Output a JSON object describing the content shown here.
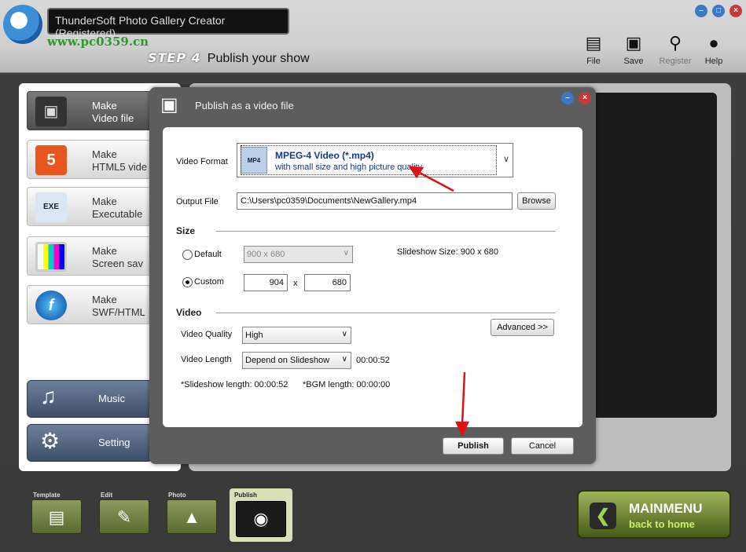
{
  "window": {
    "title": "ThunderSoft Photo Gallery Creator (Registered)",
    "watermark": "www.pc0359.cn",
    "min": "–",
    "max": "□",
    "close": "×"
  },
  "step": {
    "label": "STEP 4",
    "title": "Publish your show"
  },
  "toolbar": [
    {
      "label": "File",
      "icon": "folder-icon"
    },
    {
      "label": "Save",
      "icon": "floppy-icon"
    },
    {
      "label": "Register",
      "icon": "key-icon"
    },
    {
      "label": "Help",
      "icon": "lightbulb-icon"
    }
  ],
  "make_options": [
    {
      "label": "Make\nVideo file",
      "icon": "film-icon",
      "active": true
    },
    {
      "label": "Make\nHTML5 vide",
      "icon": "html5-icon",
      "active": false
    },
    {
      "label": "Make\nExecutable",
      "icon": "exe-icon",
      "active": false
    },
    {
      "label": "Make\nScreen sav",
      "icon": "monitor-icon",
      "active": false
    },
    {
      "label": "Make\nSWF/HTML",
      "icon": "flash-icon",
      "active": false
    }
  ],
  "side_buttons": {
    "music": "Music",
    "setting": "Setting"
  },
  "bottom_tabs": {
    "template": "Template",
    "edit": "Edit",
    "photo": "Photo",
    "publish": "Publish"
  },
  "mainmenu": {
    "title": "MAINMENU",
    "subtitle": "back to home"
  },
  "dialog": {
    "title": "Publish as a video file",
    "video_format_label": "Video Format",
    "format_name": "MPEG-4 Video (*.mp4)",
    "format_desc": "with small size and high picture quality",
    "format_icon_text": "MP4",
    "output_file_label": "Output File",
    "output_file_value": "C:\\Users\\pc0359\\Documents\\NewGallery.mp4",
    "browse": "Browse",
    "size_section": "Size",
    "default_label": "Default",
    "default_size": "900 x 680",
    "slideshow_size": "Slideshow Size: 900 x 680",
    "custom_label": "Custom",
    "custom_width": "904",
    "custom_x": "x",
    "custom_height": "680",
    "video_section": "Video",
    "advanced": "Advanced >>",
    "quality_label": "Video Quality",
    "quality_value": "High",
    "length_label": "Video Length",
    "length_value": "Depend on Slideshow",
    "length_time": "00:00:52",
    "slideshow_length": "*Slideshow length: 00:00:52",
    "bgm_length": "*BGM length: 00:00:00",
    "publish": "Publish",
    "cancel": "Cancel"
  },
  "colors": {
    "accent_arrow": "#e01010",
    "format_text": "#143a8a",
    "mainmenu_green": "#7d9a3a"
  }
}
